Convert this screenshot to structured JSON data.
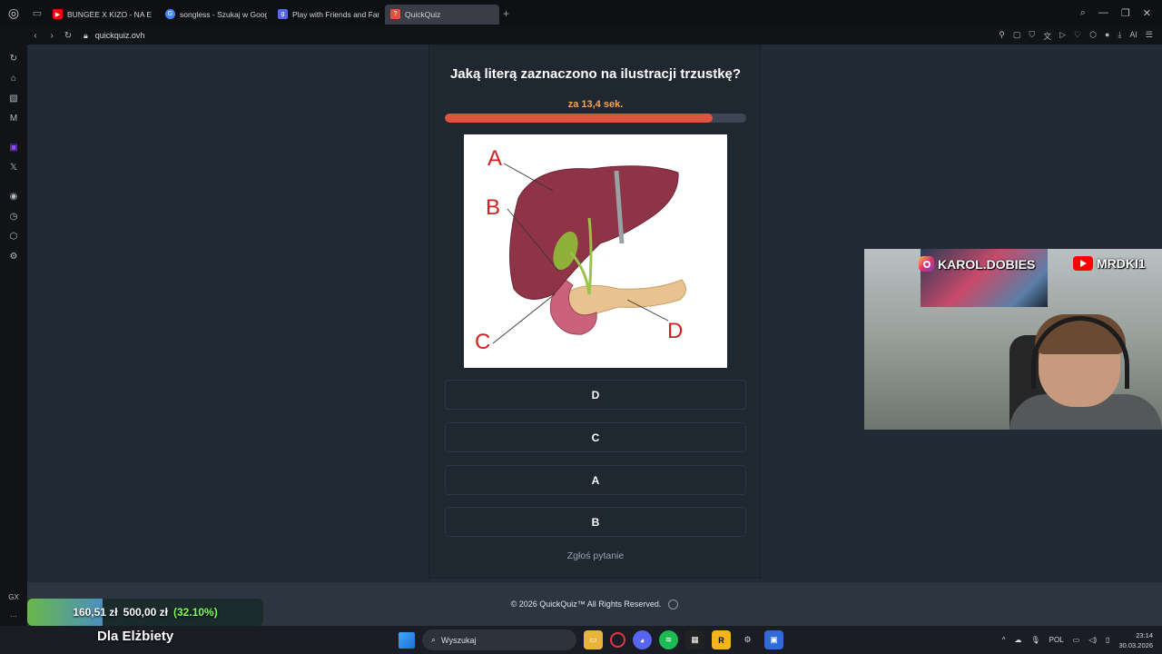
{
  "browser": {
    "tabs": [
      {
        "label": "BUNGEE X KIZO - NA E",
        "favicon_color": "#ff0000",
        "active": false
      },
      {
        "label": "songless - Szukaj w Goog",
        "favicon_color": "#4285f4",
        "active": false
      },
      {
        "label": "Play with Friends and Fam",
        "favicon_color": "#5865f2",
        "active": false
      },
      {
        "label": "QuickQuiz",
        "favicon_color": "#e0533c",
        "active": true
      }
    ],
    "url": "quickquiz.ovh"
  },
  "quiz": {
    "question": "Jaką literą zaznaczono na ilustracji trzustkę?",
    "timer_text": "za 13,4 sek.",
    "progress": 0.89,
    "answers": [
      "D",
      "C",
      "A",
      "B"
    ],
    "report_label": "Zgłoś pytanie",
    "illustration_labels": [
      "A",
      "B",
      "C",
      "D"
    ]
  },
  "footer": {
    "copyright": "© 2026  QuickQuiz™ All Rights Reserved."
  },
  "stream": {
    "instagram": "KAROL.DOBIES",
    "youtube": "MRDKI1",
    "donation_current": "160,51 zł",
    "donation_goal": "500,00 zł",
    "donation_percent": "(32.10%)",
    "donation_fraction": 0.321,
    "donation_title": "Dla Elżbiety"
  },
  "taskbar": {
    "search_placeholder": "Wyszukaj",
    "language": "POL",
    "time": "23:14",
    "date": "30.03.2026"
  }
}
